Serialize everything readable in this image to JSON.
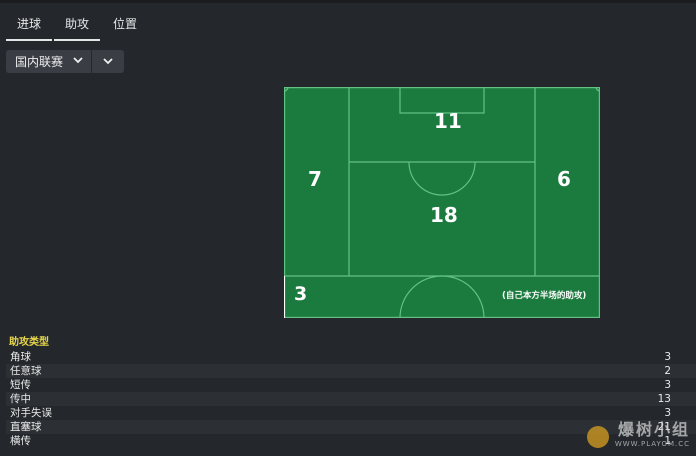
{
  "tabs": [
    {
      "label": "进球",
      "active": true
    },
    {
      "label": "助攻",
      "active": true
    },
    {
      "label": "位置",
      "active": false
    }
  ],
  "filter": {
    "selected": "国内联赛"
  },
  "pitch": {
    "color": "#1b7a3e",
    "zones": {
      "top": "11",
      "left": "7",
      "right": "6",
      "center": "18",
      "bottom": "3"
    },
    "note": "(自己本方半场的助攻)"
  },
  "assist_types": {
    "title": "助攻类型",
    "rows": [
      {
        "name": "角球",
        "value": "3"
      },
      {
        "name": "任意球",
        "value": "2"
      },
      {
        "name": "短传",
        "value": "3"
      },
      {
        "name": "传中",
        "value": "13"
      },
      {
        "name": "对手失误",
        "value": "3"
      },
      {
        "name": "直塞球",
        "value": "21"
      },
      {
        "name": "横传",
        "value": "1"
      }
    ]
  },
  "watermark": {
    "text_cn": "爆树小组",
    "text_en": "WWW.PLAYOM.CC"
  }
}
